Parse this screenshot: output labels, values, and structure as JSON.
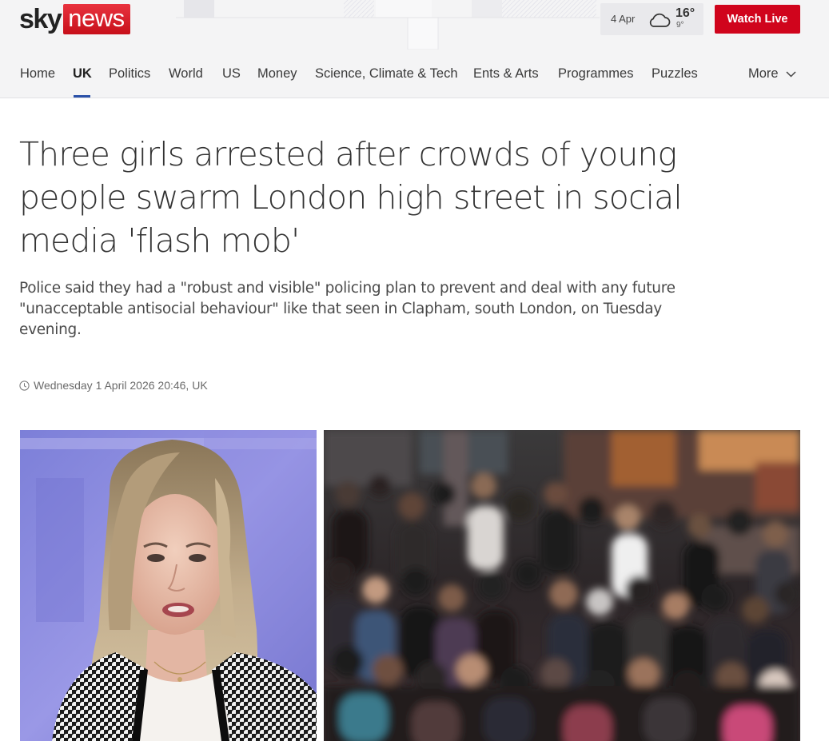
{
  "header": {
    "logo": {
      "sky": "sky",
      "news": "news"
    },
    "weather": {
      "date": "4 Apr",
      "high": "16°",
      "low": "9°",
      "icon": "cloud-icon"
    },
    "watch_live_label": "Watch Live"
  },
  "nav": {
    "items": [
      {
        "label": "Home"
      },
      {
        "label": "UK",
        "active": true
      },
      {
        "label": "Politics"
      },
      {
        "label": "World"
      },
      {
        "label": "US"
      },
      {
        "label": "Money"
      },
      {
        "label": "Science, Climate & Tech"
      },
      {
        "label": "Ents & Arts"
      },
      {
        "label": "Programmes"
      },
      {
        "label": "Puzzles"
      }
    ],
    "more_label": "More"
  },
  "article": {
    "headline": "Three girls arrested after crowds of young people swarm London high street in social media 'flash mob'",
    "standfirst": "Police said they had a \"robust and visible\" policing plan to prevent and deal with any future \"unacceptable antisocial behaviour\" like that seen in Clapham, south London, on Tuesday evening.",
    "dateline": "Wednesday 1 April 2026 20:46, UK"
  },
  "colors": {
    "brand_red": "#d0041c",
    "nav_active_underline": "#2a50a8",
    "header_bg": "#f4f4f5"
  }
}
